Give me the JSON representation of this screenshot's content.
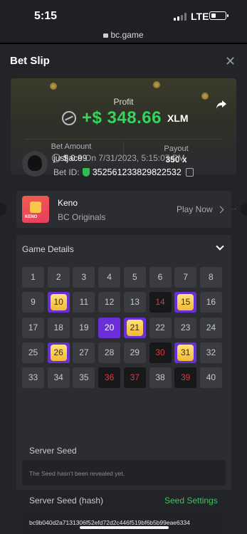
{
  "statusbar": {
    "time": "5:15",
    "network": "LTE",
    "url": "bc.game"
  },
  "sheet": {
    "title": "Bet Slip",
    "close": "✕"
  },
  "profit": {
    "label": "Profit",
    "amount": "+$ 348.66",
    "currency": "XLM",
    "bet_amount_label": "Bet Amount",
    "bet_amount": "$ 0.99",
    "payout_label": "Payout",
    "payout": "350 x"
  },
  "user": {
    "name": "justjace",
    "date": "On 7/31/2023, 5:15:07 PM",
    "bet_id_label": "Bet ID:",
    "bet_id": "352561233829822532"
  },
  "game": {
    "name": "Keno",
    "provider": "BC Originals",
    "play_label": "Play Now",
    "thumb_text": "KENO"
  },
  "details": {
    "title": "Game Details",
    "cells": [
      {
        "n": "1",
        "s": "n"
      },
      {
        "n": "2",
        "s": "n"
      },
      {
        "n": "3",
        "s": "n"
      },
      {
        "n": "4",
        "s": "n"
      },
      {
        "n": "5",
        "s": "n"
      },
      {
        "n": "6",
        "s": "n"
      },
      {
        "n": "7",
        "s": "n"
      },
      {
        "n": "8",
        "s": "n"
      },
      {
        "n": "9",
        "s": "n"
      },
      {
        "n": "10",
        "s": "hit"
      },
      {
        "n": "11",
        "s": "n"
      },
      {
        "n": "12",
        "s": "n"
      },
      {
        "n": "13",
        "s": "n"
      },
      {
        "n": "14",
        "s": "miss"
      },
      {
        "n": "15",
        "s": "hit"
      },
      {
        "n": "16",
        "s": "n"
      },
      {
        "n": "17",
        "s": "n"
      },
      {
        "n": "18",
        "s": "n"
      },
      {
        "n": "19",
        "s": "n"
      },
      {
        "n": "20",
        "s": "pick"
      },
      {
        "n": "21",
        "s": "hit"
      },
      {
        "n": "22",
        "s": "n"
      },
      {
        "n": "23",
        "s": "n"
      },
      {
        "n": "24",
        "s": "n"
      },
      {
        "n": "25",
        "s": "n"
      },
      {
        "n": "26",
        "s": "hit"
      },
      {
        "n": "27",
        "s": "n"
      },
      {
        "n": "28",
        "s": "n"
      },
      {
        "n": "29",
        "s": "n"
      },
      {
        "n": "30",
        "s": "miss"
      },
      {
        "n": "31",
        "s": "hit"
      },
      {
        "n": "32",
        "s": "n"
      },
      {
        "n": "33",
        "s": "n"
      },
      {
        "n": "34",
        "s": "n"
      },
      {
        "n": "35",
        "s": "n"
      },
      {
        "n": "36",
        "s": "miss"
      },
      {
        "n": "37",
        "s": "miss"
      },
      {
        "n": "38",
        "s": "n"
      },
      {
        "n": "39",
        "s": "miss"
      },
      {
        "n": "40",
        "s": "n"
      }
    ],
    "server_seed_label": "Server Seed",
    "server_seed_value": "The Seed hasn't been revealed yet.",
    "server_hash_label": "Server Seed (hash)",
    "seed_settings": "Seed Settings",
    "server_hash_value": "bc9b040d2a7131306f52efd72d2c446f519bf6b5b99eae6334"
  },
  "colors": {
    "accent_green": "#36d35d",
    "pick_purple": "#6b2fd8",
    "gem_gold": "#f7c64a",
    "miss_red": "#e5353b"
  }
}
